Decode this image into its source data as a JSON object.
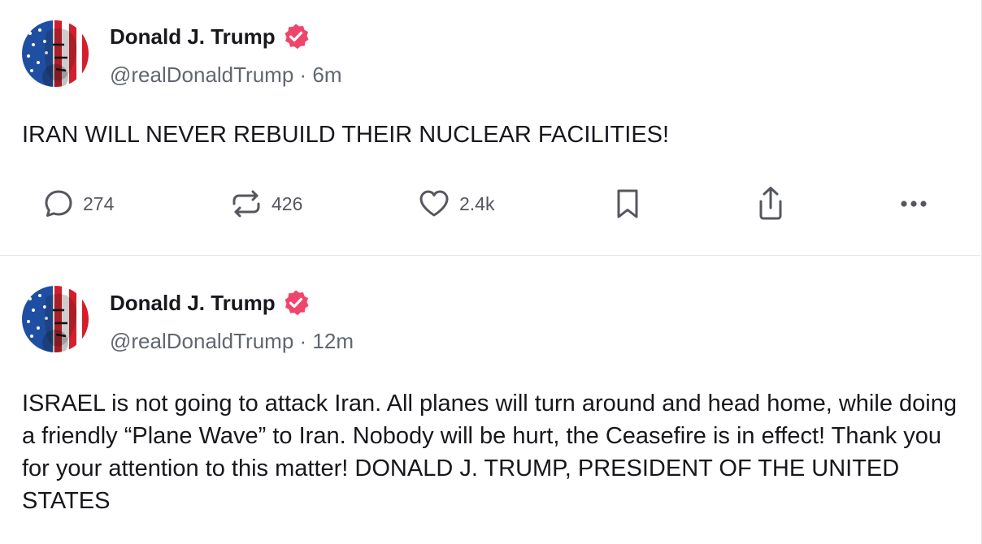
{
  "posts": [
    {
      "author": "Donald J. Trump",
      "handle": "@realDonaldTrump",
      "separator": " · ",
      "time": "6m",
      "text": "IRAN WILL NEVER REBUILD THEIR NUCLEAR FACILITIES!",
      "replies": "274",
      "reposts": "426",
      "likes": "2.4k",
      "verified_color": "#f0456b"
    },
    {
      "author": "Donald J. Trump",
      "handle": "@realDonaldTrump",
      "separator": " · ",
      "time": "12m",
      "text": "ISRAEL is not going to attack Iran. All planes will turn around and head home, while doing a friendly “Plane Wave” to Iran. Nobody will be hurt, the Ceasefire is in effect! Thank you for your attention to this matter! DONALD J. TRUMP, PRESIDENT OF THE UNITED STATES",
      "verified_color": "#f0456b"
    }
  ],
  "icons": {
    "reply": "speech-bubble-icon",
    "repost": "repost-arrows-icon",
    "like": "heart-icon",
    "bookmark": "bookmark-icon",
    "share": "share-upload-icon",
    "more": "ellipsis-icon"
  }
}
